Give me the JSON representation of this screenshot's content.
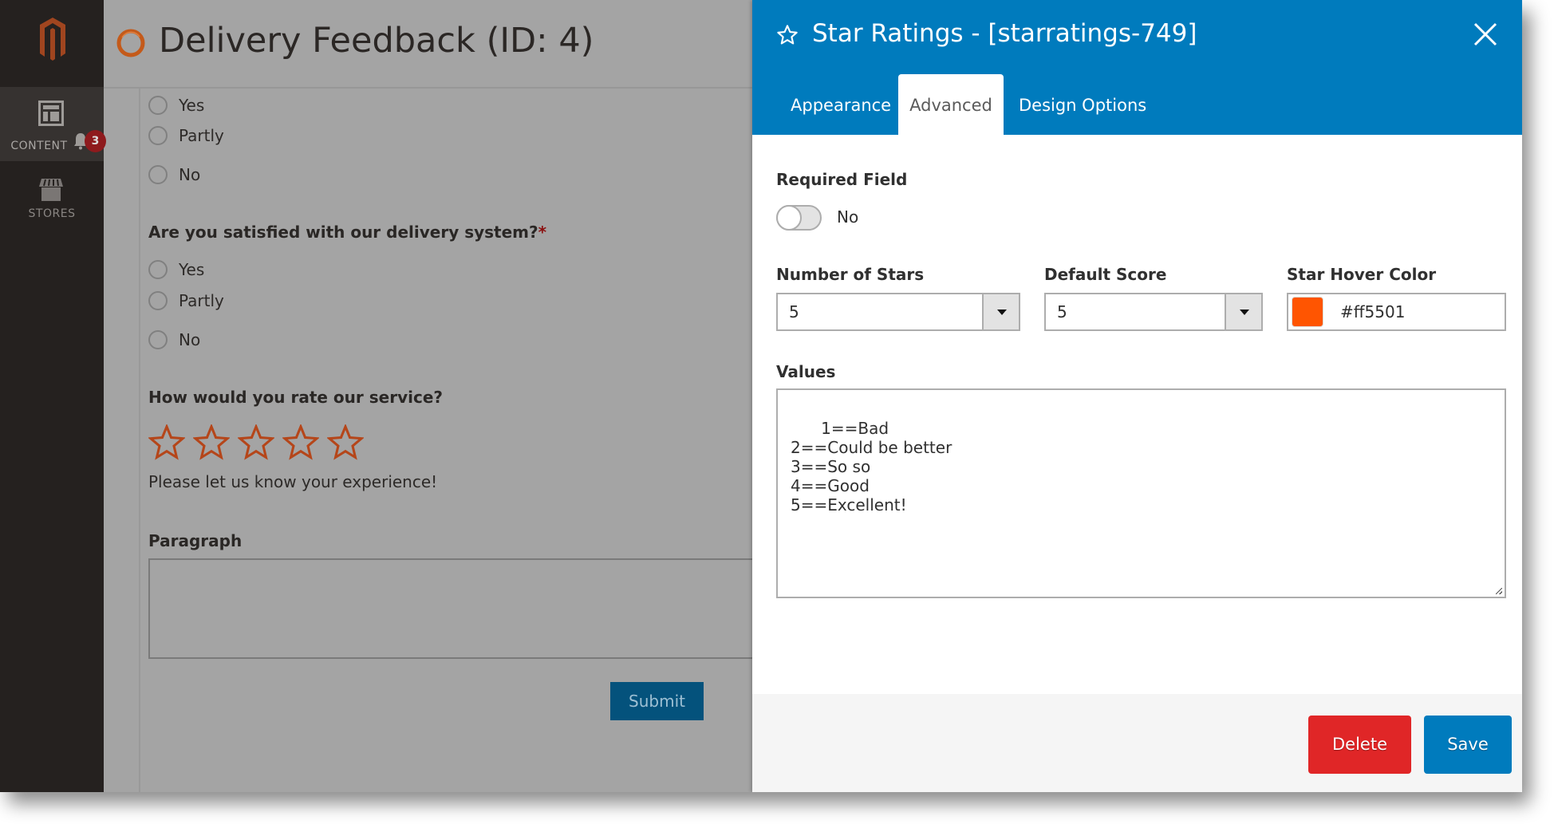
{
  "sidebar": {
    "logo_icon": "magento-logo-icon",
    "items": [
      {
        "label": "CONTENT",
        "icon": "content-layout-icon",
        "active": true
      },
      {
        "label": "STORES",
        "icon": "store-icon",
        "active": false
      }
    ],
    "notification_count": "3"
  },
  "page": {
    "title": "Delivery Feedback (ID: 4)",
    "icon": "loading-ring-icon"
  },
  "form": {
    "top_options": [
      "Yes",
      "Partly",
      "No"
    ],
    "question_1": {
      "label": "Are you satisfied with our delivery system?",
      "required_mark": "*",
      "options": [
        "Yes",
        "Partly",
        "No"
      ]
    },
    "question_2": {
      "label": "How would you rate our service?",
      "star_count": 5,
      "star_color": "#b5461a",
      "help_text": "Please let us know your experience!"
    },
    "paragraph": {
      "label": "Paragraph",
      "value": ""
    },
    "submit_label": "Submit"
  },
  "panel": {
    "title": "Star Ratings - [starratings-749]",
    "tabs": [
      {
        "label": "Appearance",
        "active": false
      },
      {
        "label": "Advanced",
        "active": true
      },
      {
        "label": "Design Options",
        "active": false
      }
    ],
    "required_field": {
      "label": "Required Field",
      "value": false,
      "value_text": "No"
    },
    "number_of_stars": {
      "label": "Number of Stars",
      "value": "5"
    },
    "default_score": {
      "label": "Default Score",
      "value": "5"
    },
    "star_hover_color": {
      "label": "Star Hover Color",
      "value": "#ff5501"
    },
    "values": {
      "label": "Values",
      "text": "1==Bad\n2==Could be better\n3==So so\n4==Good\n5==Excellent!"
    },
    "delete_label": "Delete",
    "save_label": "Save"
  },
  "colors": {
    "header_blue": "#007bbd",
    "delete_red": "#e02627",
    "save_blue": "#007bbd"
  }
}
